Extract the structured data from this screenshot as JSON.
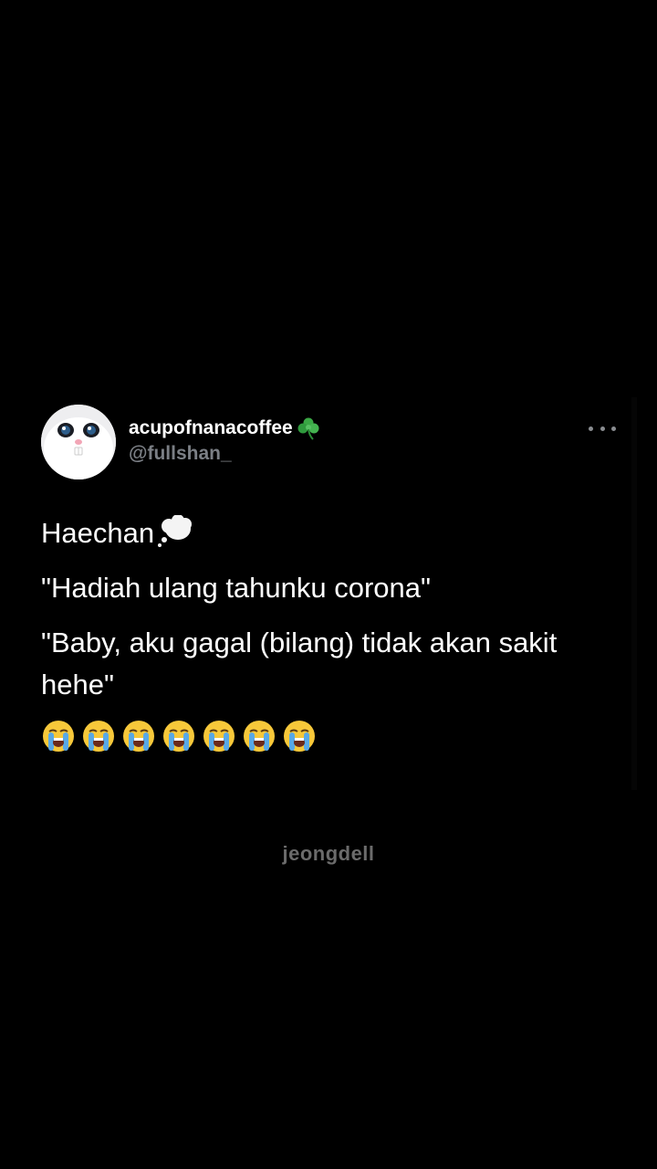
{
  "tweet": {
    "display_name": "acupofnanacoffee",
    "display_name_emoji": "shamrock-icon",
    "handle": "@fullshan_",
    "more_icon": "more-horizontal-icon",
    "lines": [
      "Haechan",
      "\"Hadiah ulang tahunku corona\"",
      "\"Baby, aku gagal (bilang) tidak akan sakit hehe\""
    ],
    "first_line_emoji": "thought-balloon-icon",
    "emoji_row": [
      "loudly-crying-face-icon",
      "loudly-crying-face-icon",
      "loudly-crying-face-icon",
      "loudly-crying-face-icon",
      "loudly-crying-face-icon",
      "loudly-crying-face-icon",
      "loudly-crying-face-icon"
    ]
  },
  "watermark": "jeongdell",
  "colors": {
    "background": "#000000",
    "text": "#ffffff",
    "handle": "#7b7f85",
    "watermark": "#6b6b6b"
  }
}
